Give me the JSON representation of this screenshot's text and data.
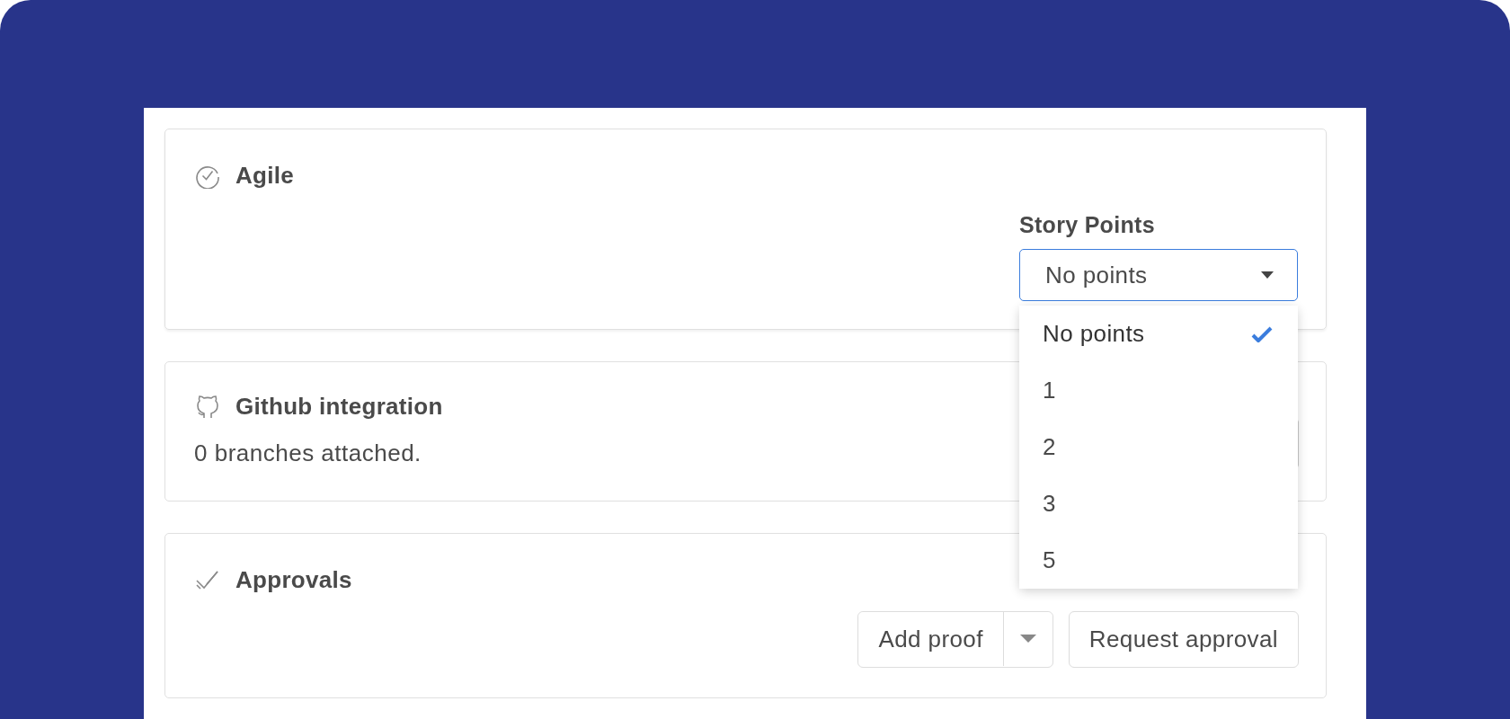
{
  "sections": [
    {
      "kind": "agile",
      "title": "Agile",
      "field": {
        "label": "Story Points",
        "value": "No points",
        "expanded": true,
        "options": [
          {
            "label": "No points",
            "selected": true
          },
          {
            "label": "1",
            "selected": false
          },
          {
            "label": "2",
            "selected": false
          },
          {
            "label": "3",
            "selected": false
          },
          {
            "label": "5",
            "selected": false
          }
        ]
      }
    },
    {
      "kind": "github",
      "title": "Github integration",
      "text": "0 branches attached."
    },
    {
      "kind": "approvals",
      "title": "Approvals",
      "buttons": [
        {
          "kind": "split",
          "label": "Add proof"
        },
        {
          "kind": "plain",
          "label": "Request approval"
        }
      ]
    }
  ]
}
